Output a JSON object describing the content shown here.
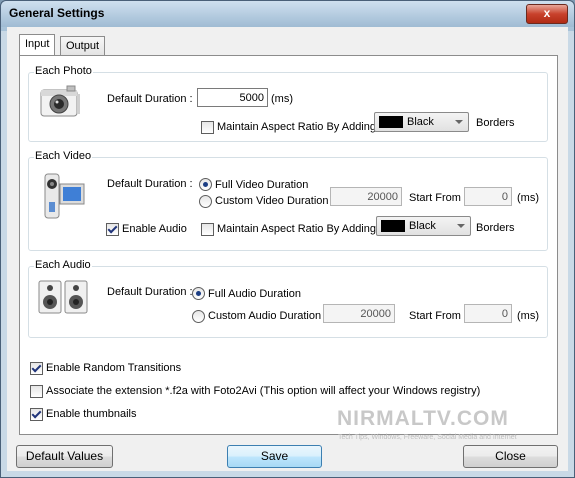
{
  "window": {
    "title": "General Settings",
    "close_label": "x"
  },
  "tabs": [
    {
      "label": "Input"
    },
    {
      "label": "Output"
    }
  ],
  "photo": {
    "group_label": "Each Photo",
    "icon": "camera-icon",
    "duration_label": "Default Duration :",
    "duration_value": "5000",
    "unit": "(ms)",
    "aspect_label": "Maintain Aspect Ratio By Adding",
    "aspect_checked": false,
    "border_color": "Black",
    "border_swatch": "#000000",
    "borders_label": "Borders"
  },
  "video": {
    "group_label": "Each Video",
    "icon": "camcorder-icon",
    "duration_label": "Default Duration :",
    "full_label": "Full Video Duration",
    "custom_label": "Custom Video Duration :",
    "custom_value": "20000",
    "start_label": "Start From :",
    "start_value": "0",
    "unit": "(ms)",
    "enable_audio_label": "Enable Audio",
    "enable_audio_checked": true,
    "aspect_label": "Maintain Aspect Ratio By Adding",
    "border_color": "Black",
    "borders_label": "Borders"
  },
  "audio": {
    "group_label": "Each Audio",
    "icon": "speakers-icon",
    "duration_label": "Default Duration :",
    "full_label": "Full Audio Duration",
    "custom_label": "Custom Audio Duration :",
    "custom_value": "20000",
    "start_label": "Start From :",
    "start_value": "0",
    "unit": "(ms)"
  },
  "options": {
    "random_transitions": "Enable Random Transitions",
    "associate": "Associate the extension *.f2a with Foto2Avi (This option will affect your Windows registry)",
    "thumbnails": "Enable thumbnails"
  },
  "watermark": {
    "text": "NIRMALTV.COM",
    "tagline": "Tech Tips, Windows, Freeware, Social Media and Internet"
  },
  "buttons": {
    "defaults": "Default Values",
    "save": "Save",
    "close": "Close"
  }
}
